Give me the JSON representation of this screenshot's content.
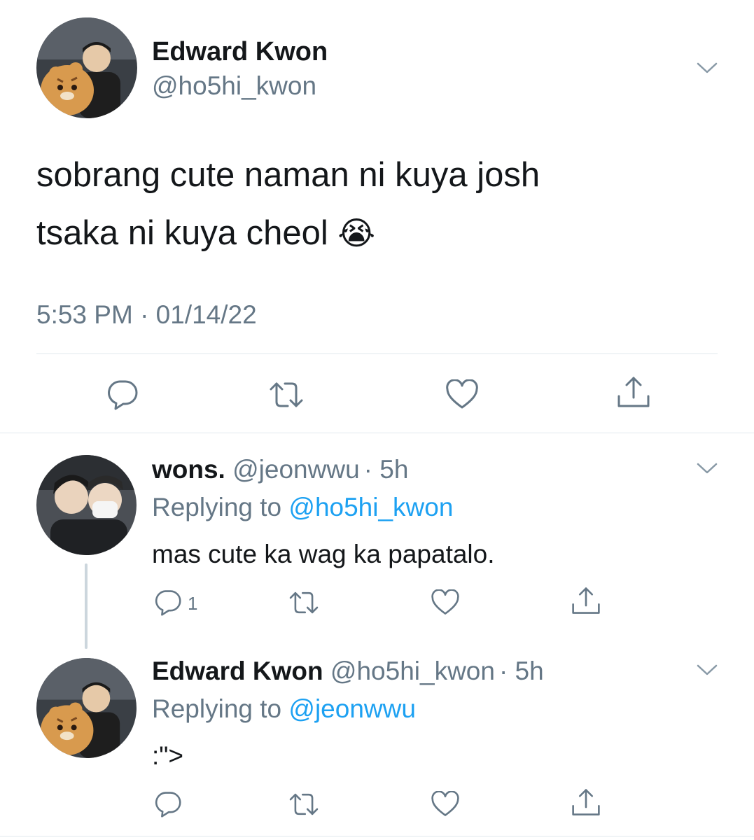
{
  "main_tweet": {
    "author_name": "Edward Kwon",
    "handle": "@ho5hi_kwon",
    "text_line1": "sobrang cute naman ni kuya josh",
    "text_line2": "tsaka ni kuya cheol",
    "emoji": "😭",
    "timestamp": "5:53 PM · 01/14/22"
  },
  "reply1": {
    "author_name": "wons.",
    "handle": "@jeonwwu",
    "time": "· 5h",
    "replying_prefix": "Replying to",
    "replying_handle": "@ho5hi_kwon",
    "text": "mas cute ka wag ka papatalo.",
    "reply_count": "1"
  },
  "reply2": {
    "author_name": "Edward Kwon",
    "handle": "@ho5hi_kwon",
    "time": "· 5h",
    "replying_prefix": "Replying to",
    "replying_handle": "@jeonwwu",
    "text": ":\">"
  },
  "icons": [
    "chevron-down-icon",
    "reply-icon",
    "retweet-icon",
    "like-icon",
    "share-icon"
  ],
  "colors": {
    "text": "#14171a",
    "muted": "#657786",
    "link": "#1da1f2",
    "divider": "#e1e8ed"
  }
}
